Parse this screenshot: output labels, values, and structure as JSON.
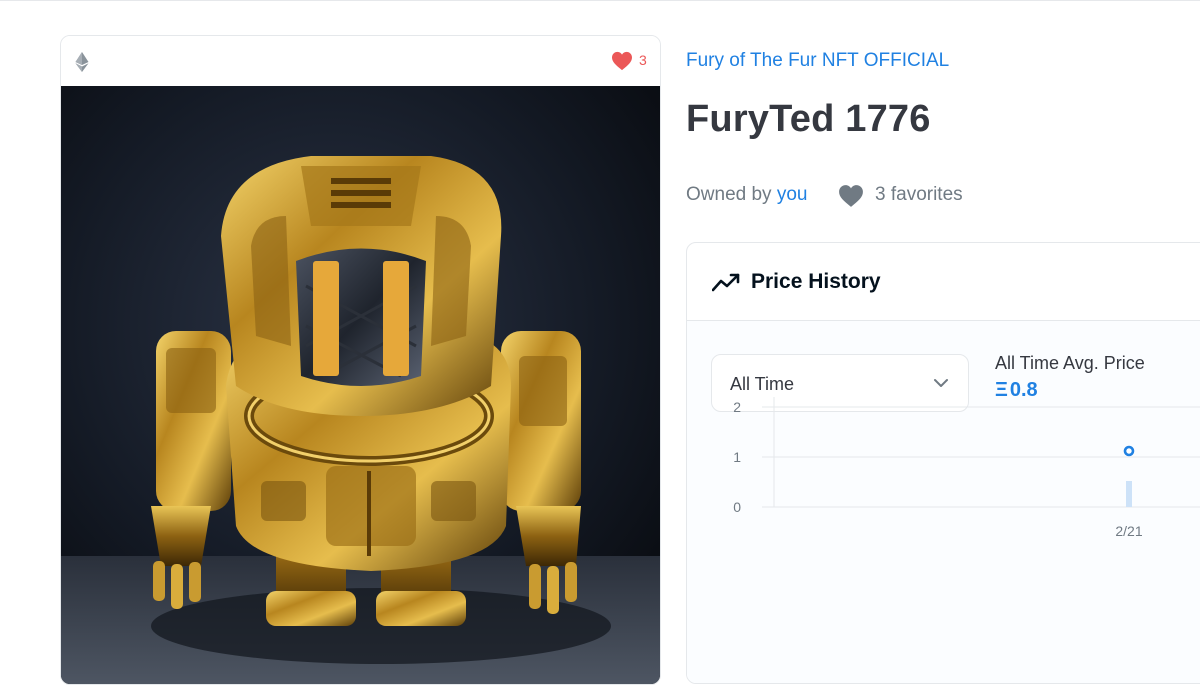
{
  "card": {
    "chain_icon": "ethereum-icon",
    "favorite_icon": "heart-icon",
    "favorite_count": "3",
    "image_alt": "Gold armored robot figure"
  },
  "collection": {
    "name": "Fury of The Fur NFT OFFICIAL"
  },
  "item": {
    "title": "FuryTed 1776",
    "owned_by_label": "Owned by",
    "owner": "you",
    "favorites_text": "3 favorites"
  },
  "price_history": {
    "title": "Price History",
    "title_icon": "trending-icon",
    "range_select": {
      "value": "All Time",
      "icon": "chevron-down-icon"
    },
    "avg_label": "All Time Avg. Price",
    "avg_symbol": "Ξ",
    "avg_value": "0.8"
  },
  "chart_data": {
    "type": "scatter",
    "y_ticks": [
      "0",
      "1",
      "2"
    ],
    "ylim": [
      0,
      2
    ],
    "x_ticks": [
      "2/21"
    ],
    "points": [
      {
        "x": "2/21",
        "y": 0.8
      }
    ],
    "grid": true
  },
  "colors": {
    "accent": "#2081e2",
    "heart": "#eb5757",
    "text": "#353840",
    "muted": "#707a83"
  }
}
